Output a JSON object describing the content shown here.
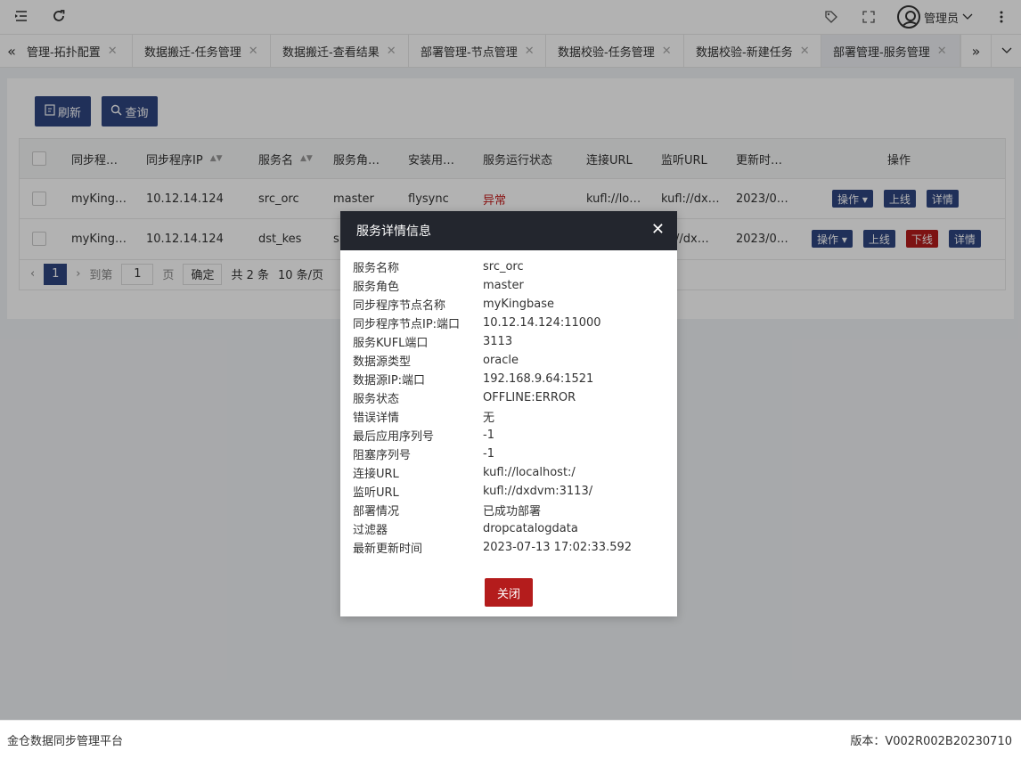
{
  "header": {
    "user_name": "管理员"
  },
  "tabs": [
    {
      "label": "管理-拓扑配置"
    },
    {
      "label": "数据搬迁-任务管理"
    },
    {
      "label": "数据搬迁-查看结果"
    },
    {
      "label": "部署管理-节点管理"
    },
    {
      "label": "数据校验-任务管理"
    },
    {
      "label": "数据校验-新建任务"
    },
    {
      "label": "部署管理-服务管理"
    }
  ],
  "toolbar": {
    "refresh_label": "刷新",
    "query_label": "查询"
  },
  "table": {
    "headers": [
      "同步程…",
      "同步程序IP",
      "服务名",
      "服务角…",
      "安装用…",
      "服务运行状态",
      "连接URL",
      "监听URL",
      "更新时…",
      "操作"
    ],
    "rows": [
      {
        "node": "myKing…",
        "ip": "10.12.14.124",
        "service": "src_orc",
        "role": "master",
        "user": "flysync",
        "status": "异常",
        "conn_url": "kufl://lo…",
        "listen_url": "kufl://dx…",
        "updated": "2023/0…"
      },
      {
        "node": "myKing…",
        "ip": "10.12.14.124",
        "service": "dst_kes",
        "role": "sl",
        "user": "",
        "status": "",
        "conn_url": "",
        "listen_url": "l://dx…",
        "updated": "2023/0…"
      }
    ],
    "actions": {
      "op": "操作 ▾",
      "online": "上线",
      "offline": "下线",
      "detail": "详情"
    }
  },
  "pager": {
    "current": "1",
    "goto_label": "到第",
    "page_label": "页",
    "confirm": "确定",
    "total": "共 2 条",
    "page_size": "10 条/页"
  },
  "modal": {
    "title": "服务详情信息",
    "close_label": "关闭",
    "fields": [
      {
        "label": "服务名称",
        "value": "src_orc"
      },
      {
        "label": "服务角色",
        "value": "master"
      },
      {
        "label": "同步程序节点名称",
        "value": "myKingbase"
      },
      {
        "label": "同步程序节点IP:端口",
        "value": "10.12.14.124:11000"
      },
      {
        "label": "服务KUFL端口",
        "value": "3113"
      },
      {
        "label": "数据源类型",
        "value": "oracle"
      },
      {
        "label": "数据源IP:端口",
        "value": "192.168.9.64:1521"
      },
      {
        "label": "服务状态",
        "value": "OFFLINE:ERROR"
      },
      {
        "label": "错误详情",
        "value": "无"
      },
      {
        "label": "最后应用序列号",
        "value": "-1"
      },
      {
        "label": "阻塞序列号",
        "value": "-1"
      },
      {
        "label": "连接URL",
        "value": "kufl://localhost:/"
      },
      {
        "label": "监听URL",
        "value": "kufl://dxdvm:3113/"
      },
      {
        "label": "部署情况",
        "value": "已成功部署"
      },
      {
        "label": "过滤器",
        "value": "dropcatalogdata"
      },
      {
        "label": "最新更新时间",
        "value": "2023-07-13 17:02:33.592"
      }
    ]
  },
  "footer": {
    "platform": "金仓数据同步管理平台",
    "version": "版本：V002R002B20230710"
  }
}
